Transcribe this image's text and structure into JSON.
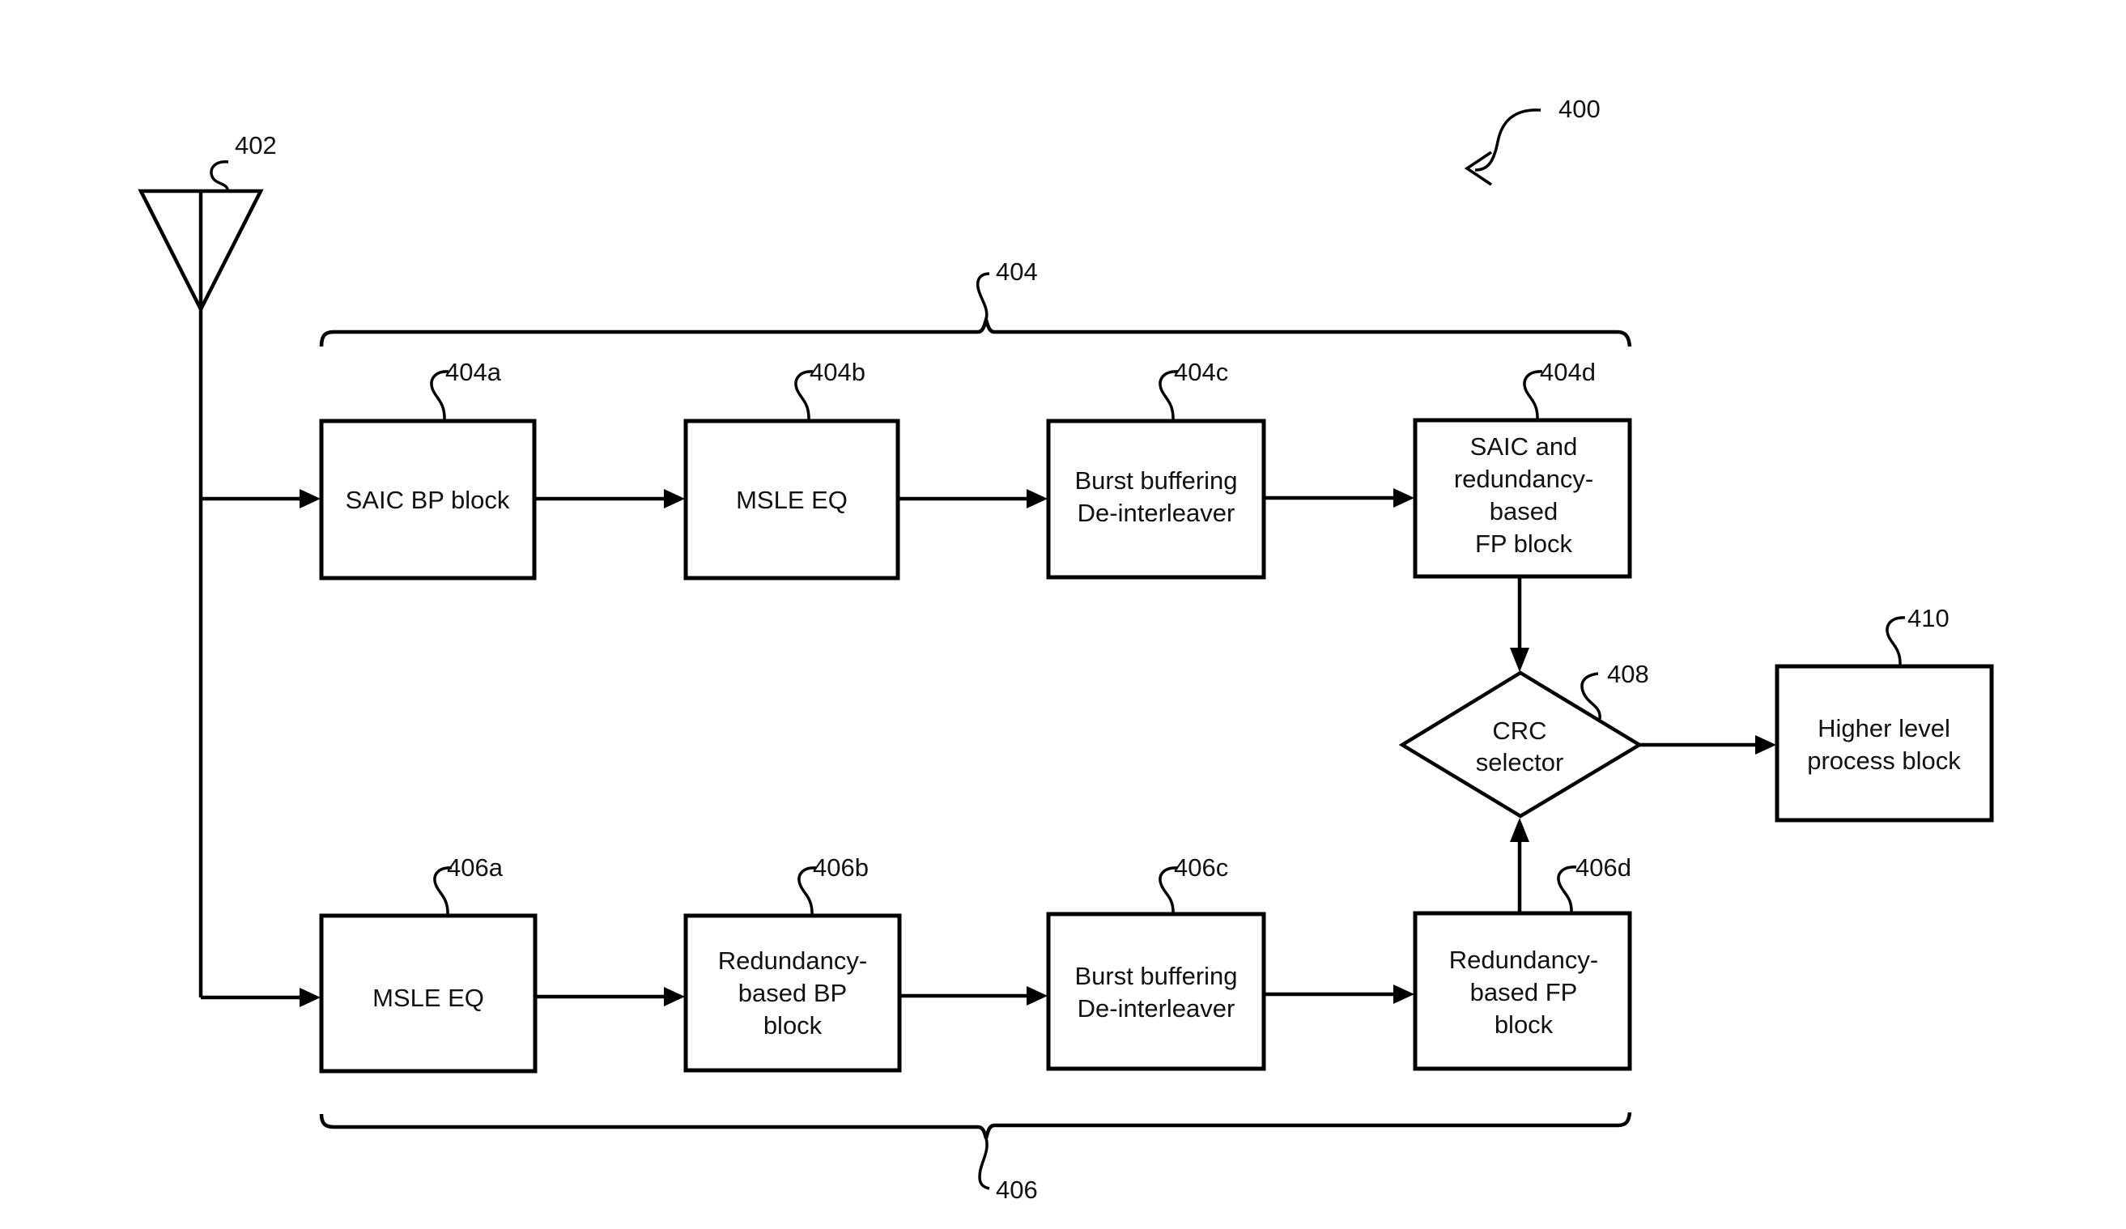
{
  "figure": {
    "ref": "400",
    "antenna": {
      "ref": "402",
      "icon": "antenna-icon"
    },
    "branches": {
      "top": {
        "ref": "404",
        "blocks": [
          {
            "ref": "404a",
            "lines": [
              "SAIC BP block"
            ]
          },
          {
            "ref": "404b",
            "lines": [
              "MSLE EQ"
            ]
          },
          {
            "ref": "404c",
            "lines": [
              "Burst buffering",
              "De-interleaver"
            ]
          },
          {
            "ref": "404d",
            "lines": [
              "SAIC and",
              "redundancy-",
              "based",
              "FP block"
            ]
          }
        ]
      },
      "bottom": {
        "ref": "406",
        "blocks": [
          {
            "ref": "406a",
            "lines": [
              "MSLE EQ"
            ]
          },
          {
            "ref": "406b",
            "lines": [
              "Redundancy-",
              "based BP",
              "block"
            ]
          },
          {
            "ref": "406c",
            "lines": [
              "Burst buffering",
              "De-interleaver"
            ]
          },
          {
            "ref": "406d",
            "lines": [
              "Redundancy-",
              "based FP",
              "block"
            ]
          }
        ]
      }
    },
    "selector": {
      "ref": "408",
      "lines": [
        "CRC",
        "selector"
      ]
    },
    "output": {
      "ref": "410",
      "lines": [
        "Higher level",
        "process block"
      ]
    }
  }
}
